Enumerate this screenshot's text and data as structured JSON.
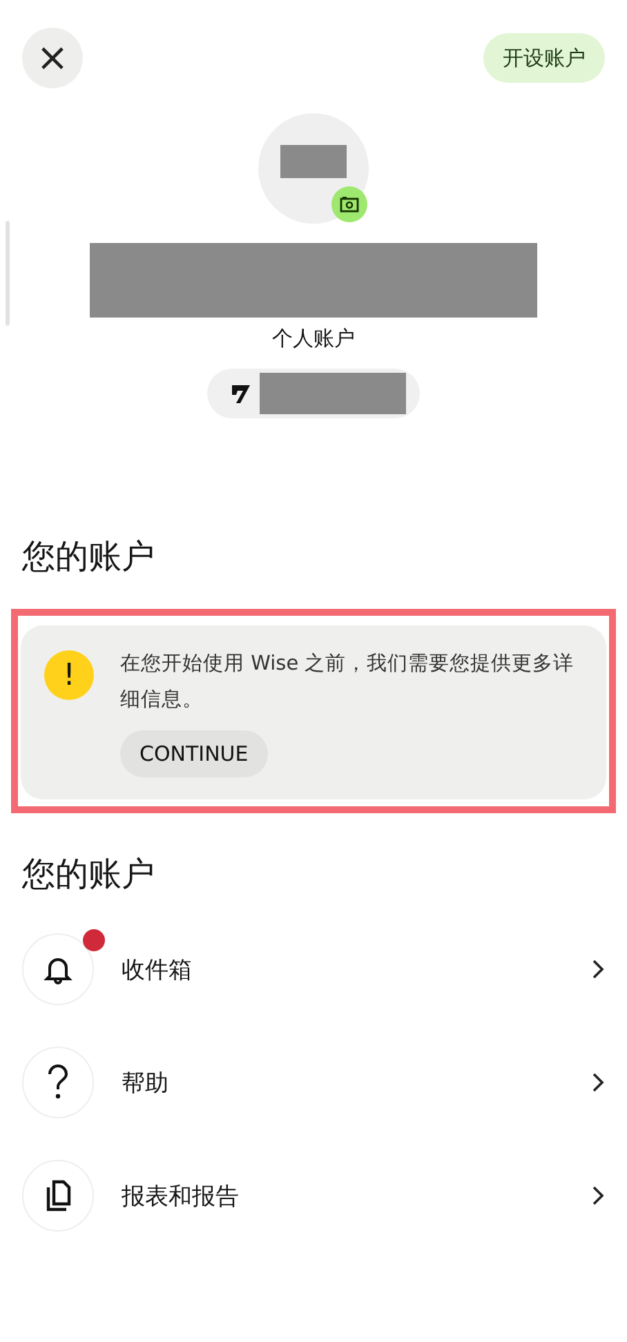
{
  "header": {
    "close_icon": "×",
    "open_account_button": "开设账户"
  },
  "profile": {
    "account_type": "个人账户"
  },
  "section_title": "您的账户",
  "notice": {
    "highlighted": true,
    "icon": "!",
    "message": "在您开始使用 Wise 之前，我们需要您提供更多详细信息。",
    "button": "CONTINUE"
  },
  "menu_title": "您的账户",
  "menu_items": [
    {
      "kind": "bell",
      "label": "收件箱",
      "unread": true
    },
    {
      "kind": "help",
      "label": "帮助",
      "unread": false
    },
    {
      "kind": "documents",
      "label": "报表和报告",
      "unread": false
    }
  ]
}
